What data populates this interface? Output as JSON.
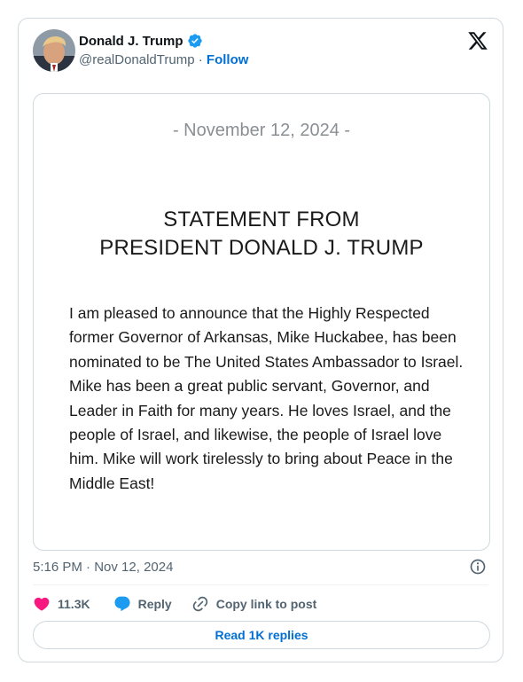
{
  "author": {
    "name": "Donald J. Trump",
    "handle": "@realDonaldTrump",
    "separator": "·",
    "follow_label": "Follow"
  },
  "media": {
    "date_line": "- November 12, 2024 -",
    "heading_line1": "STATEMENT FROM",
    "heading_line2": "PRESIDENT DONALD J. TRUMP",
    "body": "I am pleased to announce that the Highly Respected former Governor of Arkansas, Mike Huckabee, has been nominated to be The United States Ambassador to Israel. Mike has been a great public servant, Governor, and Leader in Faith for many years. He loves Israel, and the people of Israel, and likewise, the people of Israel love him. Mike will work tirelessly to bring about Peace in the Middle East!"
  },
  "meta": {
    "time": "5:16 PM",
    "separator": "·",
    "date": "Nov 12, 2024"
  },
  "actions": {
    "like_count": "11.3K",
    "reply_label": "Reply",
    "copy_label": "Copy link to post"
  },
  "footer": {
    "read_replies_label": "Read 1K replies"
  },
  "colors": {
    "accent": "#006fd6",
    "verified": "#1d9bf0",
    "like": "#f91880",
    "muted": "#536471"
  },
  "icons": {
    "brand": "x-logo-icon",
    "verified": "verified-badge-icon",
    "info": "info-icon",
    "like": "heart-icon",
    "reply": "reply-bubble-icon",
    "copy": "link-icon"
  }
}
